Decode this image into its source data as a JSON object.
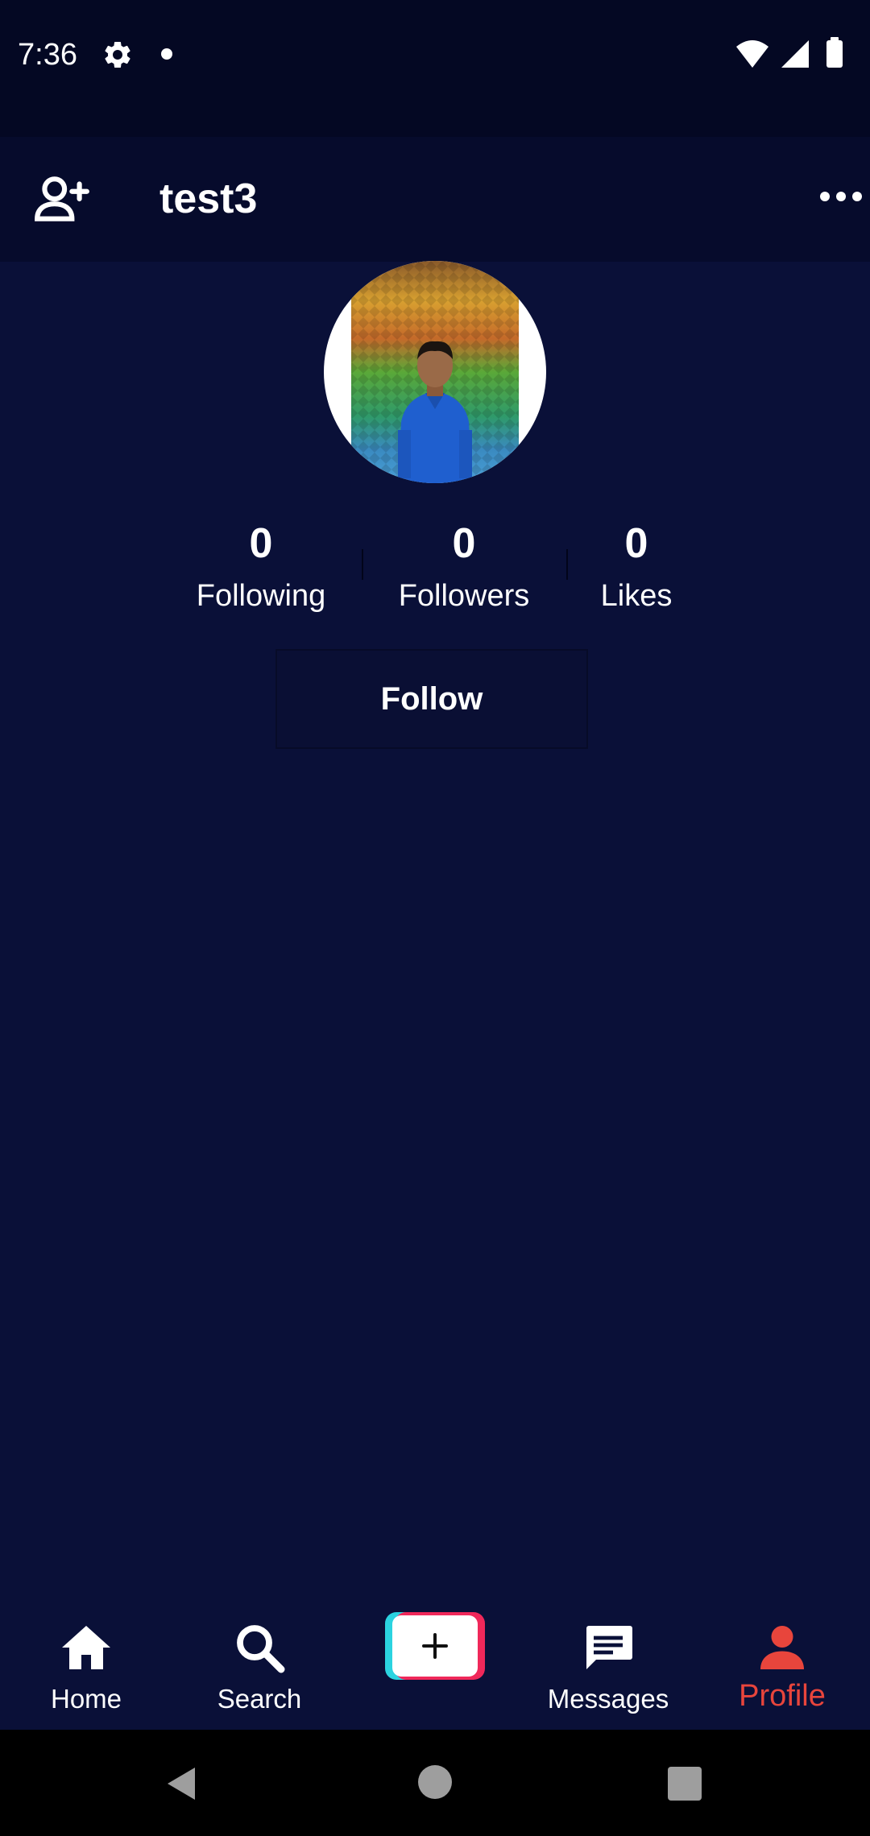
{
  "status_bar": {
    "time": "7:36"
  },
  "header": {
    "title": "test3"
  },
  "stats": [
    {
      "value": "0",
      "label": "Following"
    },
    {
      "value": "0",
      "label": "Followers"
    },
    {
      "value": "0",
      "label": "Likes"
    }
  ],
  "follow_button": {
    "label": "Follow"
  },
  "bottom_nav": {
    "items": [
      {
        "label": "Home",
        "icon": "home-icon"
      },
      {
        "label": "Search",
        "icon": "search-icon"
      },
      {
        "label": "Messages",
        "icon": "messages-icon"
      },
      {
        "label": "Profile",
        "icon": "profile-icon",
        "active": true
      }
    ]
  },
  "colors": {
    "background": "#0a1038",
    "status_bar": "#040823",
    "header": "#060b2c",
    "active_accent": "#e8453c",
    "create_cyan": "#2bd3e0",
    "create_pink": "#f0285a"
  }
}
